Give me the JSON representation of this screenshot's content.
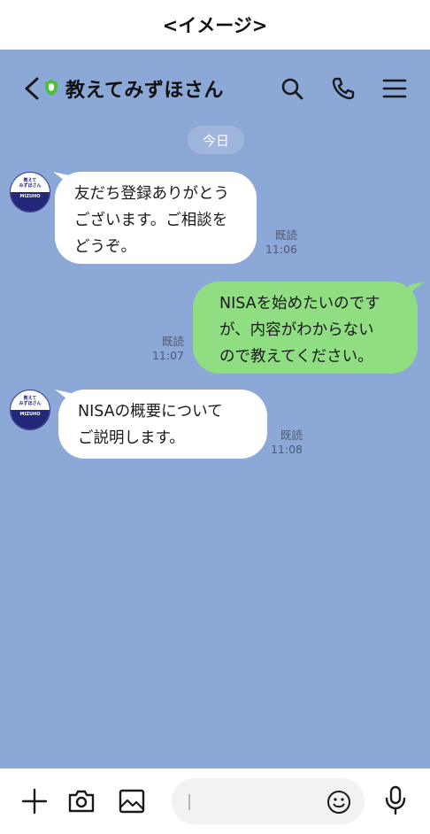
{
  "caption": "<イメージ>",
  "header": {
    "title": "教えてみずほさん"
  },
  "date_chip": "今日",
  "avatar": {
    "top_text_line1": "教えて",
    "top_text_line2": "みずほさん",
    "logo_text": "MIZUHO"
  },
  "messages": [
    {
      "direction": "incoming",
      "lines": [
        "友だち登録ありがとう",
        "ございます。ご相談を",
        "どうぞ。"
      ],
      "read": "既読",
      "time": "11:06"
    },
    {
      "direction": "outgoing",
      "lines": [
        "NISAを始めたいのです",
        "が、内容がわからない",
        "ので教えてください。"
      ],
      "read": "既読",
      "time": "11:07"
    },
    {
      "direction": "incoming",
      "lines": [
        "NISAの概要について",
        "ご説明します。"
      ],
      "read": "既読",
      "time": "11:08"
    }
  ],
  "input": {
    "value": "",
    "placeholder": ""
  },
  "colors": {
    "chat_background": "#8ba8d6",
    "outgoing_bubble": "#8fde82",
    "incoming_bubble": "#ffffff",
    "date_chip": "#9fb5dc",
    "verified_badge": "#4cbf3a"
  },
  "icons": {
    "header": [
      "back-icon",
      "verified-shield-icon",
      "search-icon",
      "phone-icon",
      "menu-icon"
    ],
    "input_bar": [
      "plus-icon",
      "camera-icon",
      "image-icon",
      "emoji-icon",
      "mic-icon"
    ]
  }
}
